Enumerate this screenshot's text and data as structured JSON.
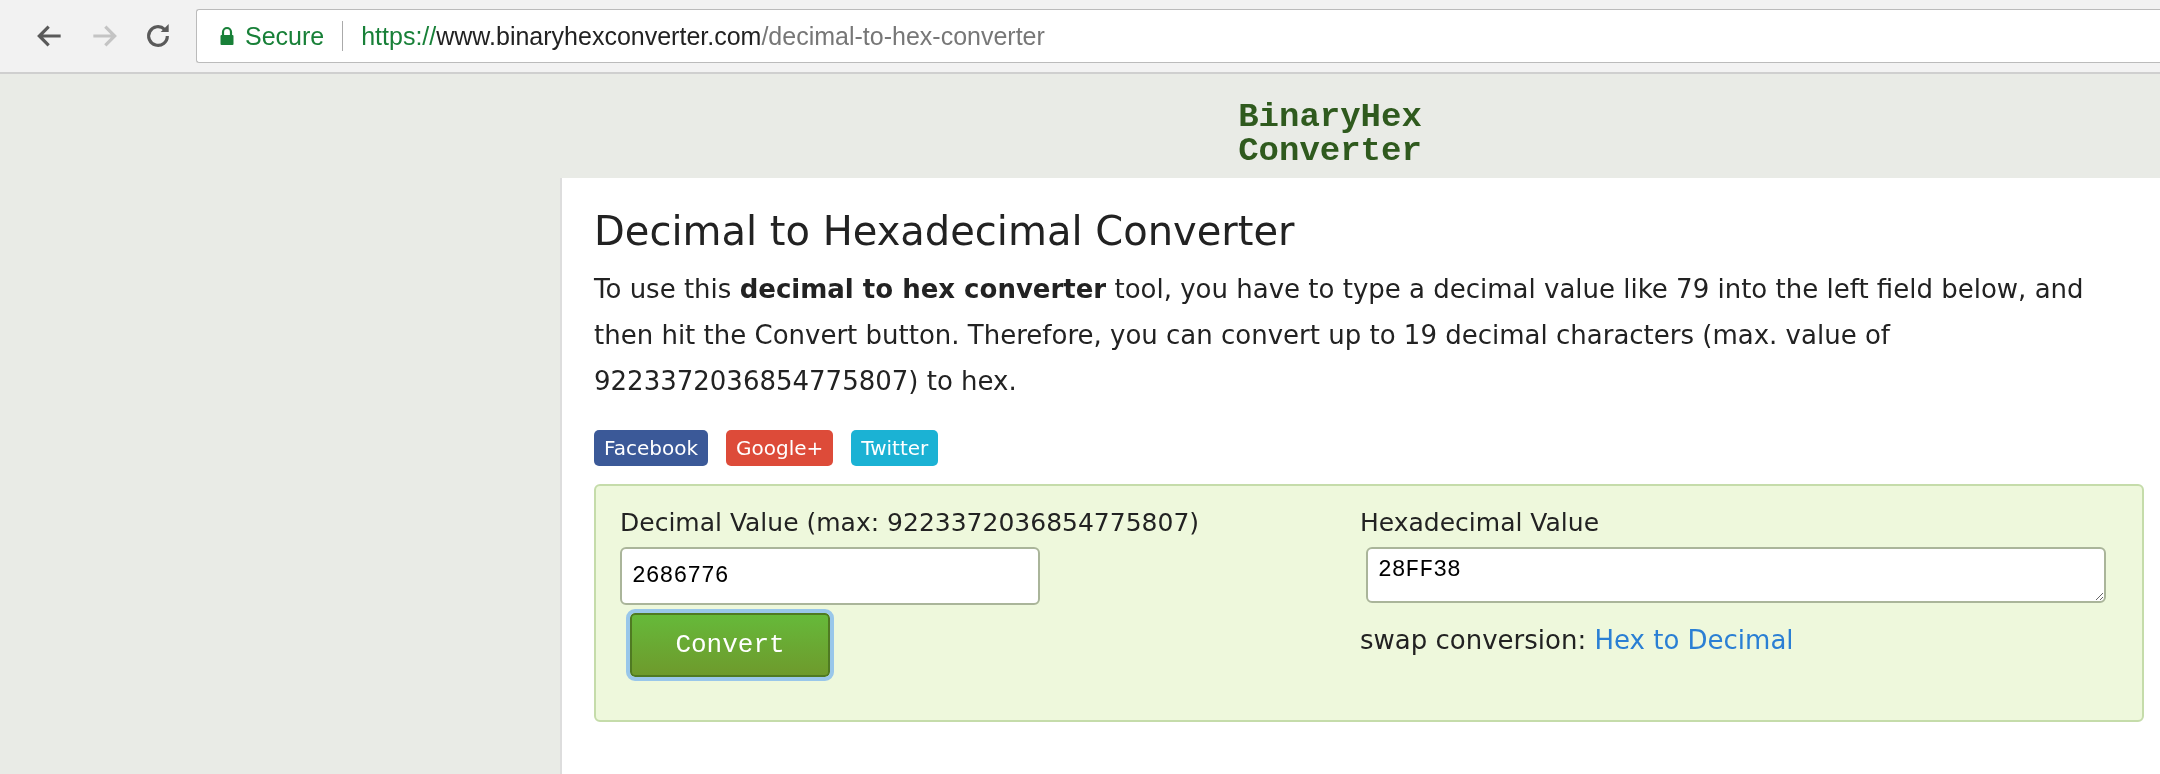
{
  "browser": {
    "secure_label": "Secure",
    "url": {
      "scheme": "https://",
      "host": "www.binaryhexconverter.com",
      "path": "/decimal-to-hex-converter"
    }
  },
  "logo": [
    "BinaryHex",
    "Converter"
  ],
  "heading": "Decimal to Hexadecimal Converter",
  "intro": "To use this **decimal to hex converter** tool, you have to type a decimal value like 79 into the left field below, and then hit the Convert button. Therefore, you can convert up to 19 decimal characters (max. value of 9223372036854775807) to hex.",
  "share_buttons": [
    {
      "label": "Facebook",
      "color": "#3b5998"
    },
    {
      "label": "Google+",
      "color": "#dd4b39"
    },
    {
      "label": "Twitter",
      "color": "#1bb2d4"
    }
  ],
  "converter": {
    "input_label": "Decimal Value (max: 9223372036854775807)",
    "input_value": "2686776",
    "convert_button": "Convert",
    "output_label": "Hexadecimal Value",
    "output_value": "28FF38",
    "swap_label": "swap conversion:",
    "swap_link": "Hex to Decimal"
  }
}
